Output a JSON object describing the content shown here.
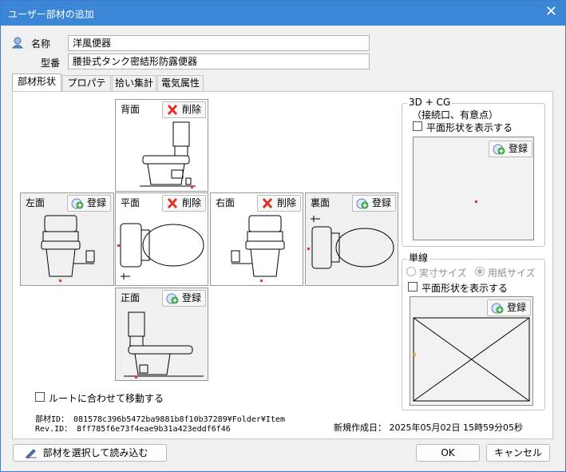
{
  "window": {
    "title": "ユーザー部材の追加",
    "close_glyph": "✕"
  },
  "fields": {
    "name_label": "名称",
    "name_value": "洋風便器",
    "model_label": "型番",
    "model_value": "腰掛式タンク密結形防露便器"
  },
  "tabs": [
    {
      "label": "部材形状",
      "active": true
    },
    {
      "label": "プロパティ",
      "active": false
    },
    {
      "label": "拾い集計",
      "active": false
    },
    {
      "label": "電気属性",
      "active": false
    }
  ],
  "views": {
    "back": {
      "label": "背面",
      "button": "削除",
      "button_icon": "delete-x-icon"
    },
    "left": {
      "label": "左面",
      "button": "登録",
      "button_icon": "register-icon"
    },
    "plan": {
      "label": "平面",
      "button": "削除",
      "button_icon": "delete-x-icon"
    },
    "right": {
      "label": "右面",
      "button": "削除",
      "button_icon": "delete-x-icon"
    },
    "rear": {
      "label": "裏面",
      "button": "登録",
      "button_icon": "register-icon"
    },
    "front": {
      "label": "正面",
      "button": "登録",
      "button_icon": "register-icon"
    }
  },
  "group_3d": {
    "title": "3D + CG",
    "subtitle": "（接続口、有意点）",
    "show_plan_label": "平面形状を表示する",
    "register_button": "登録"
  },
  "group_single": {
    "title": "単線",
    "radio_actual": "実寸サイズ",
    "radio_paper": "用紙サイズ",
    "show_plan_label": "平面形状を表示する",
    "register_button": "登録"
  },
  "route_checkbox": "ルートに合わせて移動する",
  "ids": {
    "part_id": "部材ID： 081578c396b5472ba9881b8f10b37289¥Folder¥Item",
    "rev_id": "Rev.ID： 8ff785f6e73f4eae9b31a423eddf6f46"
  },
  "created": "新規作成日： 2025年05月02日 15時59分05秒",
  "buttons": {
    "load": "部材を選択して読み込む",
    "ok": "OK",
    "cancel": "キャンセル"
  },
  "colors": {
    "titlebar": "#3c86d8",
    "delete_x": "#e0322b",
    "register_green": "#3aa845"
  }
}
